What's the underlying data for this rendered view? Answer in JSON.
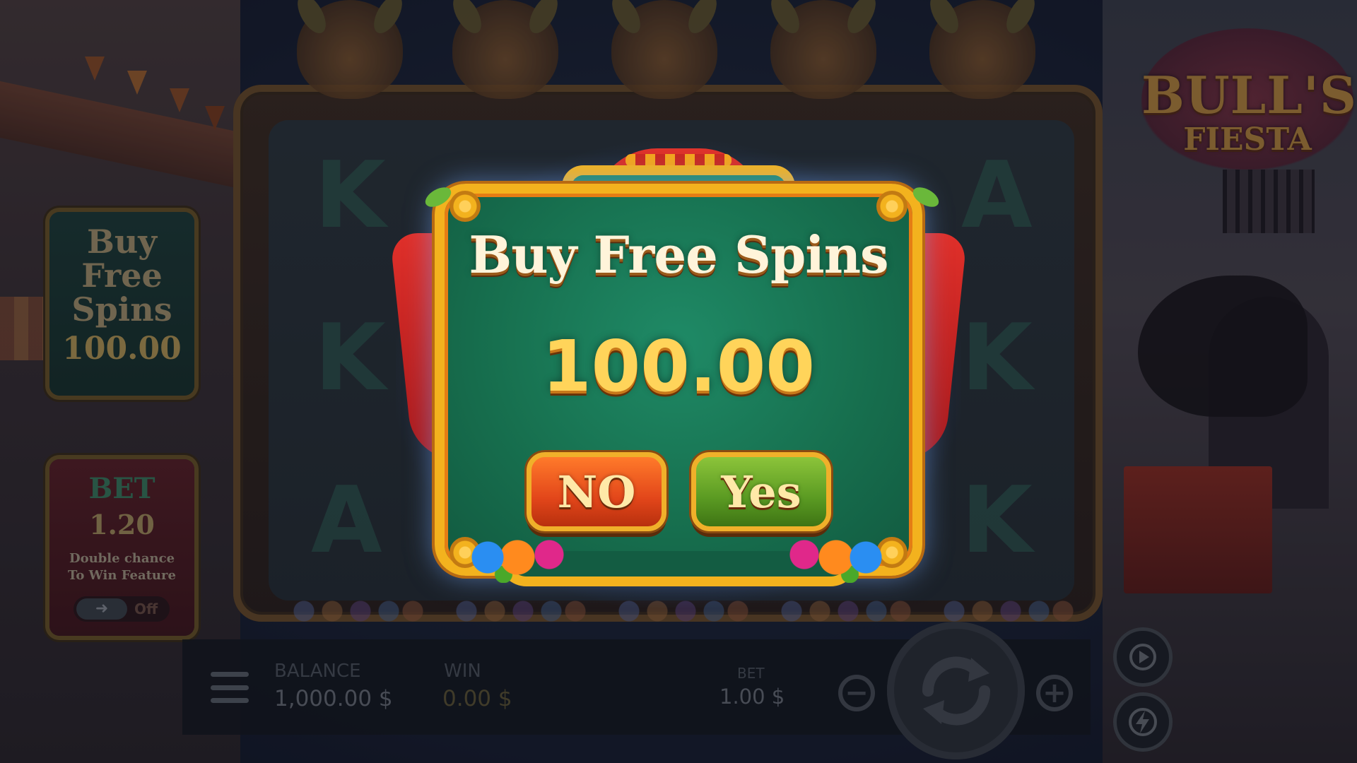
{
  "game": {
    "logo_line1": "BULL'S",
    "logo_line2": "FIESTA"
  },
  "reels": {
    "letters": [
      "K",
      "K",
      "A",
      "A",
      "K",
      "K"
    ]
  },
  "side_panels": {
    "buy": {
      "title_line1": "Buy",
      "title_line2": "Free",
      "title_line3": "Spins",
      "price": "100.00"
    },
    "bet": {
      "title": "BET",
      "value": "1.20",
      "desc_line1": "Double chance",
      "desc_line2": "To Win Feature",
      "toggle_arrow": "➜",
      "toggle_state": "Off"
    }
  },
  "bottom_bar": {
    "balance_label": "BALANCE",
    "balance_value": "1,000.00 $",
    "win_label": "WIN",
    "win_value": "0.00 $",
    "bet_label": "BET",
    "bet_value": "1.00 $",
    "minus": "−",
    "plus": "+"
  },
  "modal": {
    "title": "Buy Free Spins",
    "price": "100.00",
    "no_label": "NO",
    "yes_label": "Yes"
  },
  "colors": {
    "modal_green": "#17704f",
    "gold_border": "#f3b21e",
    "no_button": "#e2461a",
    "yes_button": "#5a9a22"
  },
  "icons": [
    "menu-icon",
    "spin-icon",
    "autoplay-icon",
    "turbo-icon",
    "minus-icon",
    "plus-icon",
    "arrow-icon"
  ]
}
